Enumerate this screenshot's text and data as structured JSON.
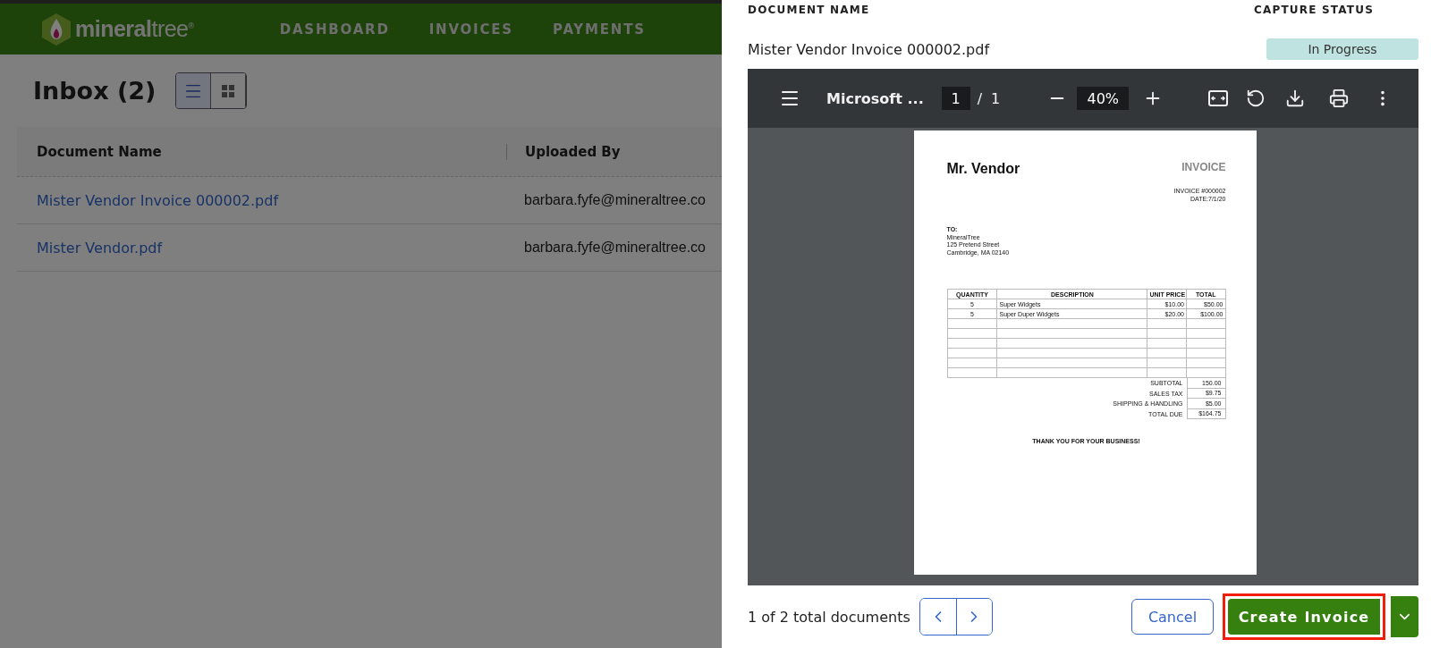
{
  "header": {
    "logo": "**mineral**tree$^{®}$",
    "nav": [
      {
        "label": "DASHBOARD"
      },
      {
        "label": "INVOICES"
      },
      {
        "label": "PAYMENTS"
      }
    ]
  },
  "inbox": {
    "title": "Inbox (2)",
    "views": [
      {
        "kind": "list",
        "selected": true
      },
      {
        "kind": "grid",
        "selected": false
      }
    ],
    "columns": [
      "Document Name",
      "Uploaded By"
    ],
    "rows": [
      {
        "document": "Mister Vendor Invoice 000002.pdf",
        "uploaded_by": "barbara.fyfe@mineraltree.co"
      },
      {
        "document": "Mister Vendor.pdf",
        "uploaded_by": "barbara.fyfe@mineraltree.co"
      }
    ]
  },
  "drawer": {
    "document_name_label": "DOCUMENT NAME",
    "capture_status_label": "CAPTURE STATUS",
    "document_name": "Mister Vendor Invoice 000002.pdf",
    "capture_status": "In Progress",
    "viewer": {
      "title": "Microsoft ...",
      "page": "1",
      "page_sep": "/",
      "page_count": "1",
      "zoom": "40%"
    },
    "invoice": {
      "vendor": "Mr. Vendor",
      "doc_type": "INVOICE",
      "meta": [
        "INVOICE #000002",
        "DATE:7/1/20"
      ],
      "to_label": "TO:",
      "address": [
        "MineralTree",
        "125 Pretend Street",
        "Cambridge, MA 02140"
      ],
      "columns": [
        "QUANTITY",
        "DESCRIPTION",
        "UNIT PRICE",
        "TOTAL"
      ],
      "items": [
        [
          "5",
          "Super Widgets",
          "$10.00",
          "$50.00"
        ],
        [
          "5",
          "Super Duper Widgets",
          "$20.00",
          "$100.00"
        ]
      ],
      "totals": [
        {
          "label": "SUBTOTAL",
          "value": "150.00"
        },
        {
          "label": "SALES TAX",
          "value": "$9.75"
        },
        {
          "label": "SHIPPING & HANDLING",
          "value": "$5.00"
        },
        {
          "label": "TOTAL DUE",
          "value": "$164.75"
        }
      ],
      "thanks": "THANK YOU FOR YOUR BUSINESS!"
    },
    "footer": {
      "count": "1 of 2 total documents",
      "cancel": "Cancel",
      "create": "Create Invoice",
      "create_highlighted": true
    }
  }
}
